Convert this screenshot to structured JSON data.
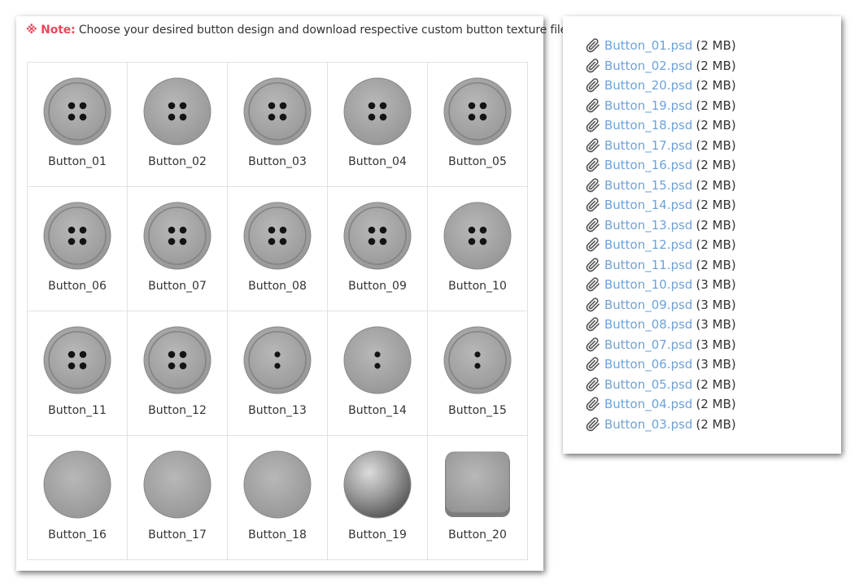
{
  "note": {
    "prefix": "※ Note:",
    "text": "Choose your desired button design and download respective custom button texture file"
  },
  "buttons": [
    {
      "label": "Button_01",
      "holes": 4,
      "rim": true
    },
    {
      "label": "Button_02",
      "holes": 4,
      "rim": false
    },
    {
      "label": "Button_03",
      "holes": 4,
      "rim": true
    },
    {
      "label": "Button_04",
      "holes": 4,
      "rim": false
    },
    {
      "label": "Button_05",
      "holes": 4,
      "rim": true
    },
    {
      "label": "Button_06",
      "holes": 4,
      "rim": true
    },
    {
      "label": "Button_07",
      "holes": 4,
      "rim": true
    },
    {
      "label": "Button_08",
      "holes": 4,
      "rim": true
    },
    {
      "label": "Button_09",
      "holes": 4,
      "rim": true
    },
    {
      "label": "Button_10",
      "holes": 4,
      "rim": false
    },
    {
      "label": "Button_11",
      "holes": 4,
      "rim": true
    },
    {
      "label": "Button_12",
      "holes": 4,
      "rim": true
    },
    {
      "label": "Button_13",
      "holes": 2,
      "rim": true
    },
    {
      "label": "Button_14",
      "holes": 2,
      "rim": false
    },
    {
      "label": "Button_15",
      "holes": 2,
      "rim": true
    },
    {
      "label": "Button_16",
      "holes": 0,
      "rim": false
    },
    {
      "label": "Button_17",
      "holes": 0,
      "rim": false
    },
    {
      "label": "Button_18",
      "holes": 0,
      "rim": false
    },
    {
      "label": "Button_19",
      "holes": 0,
      "rim": false,
      "shape": "sphere"
    },
    {
      "label": "Button_20",
      "holes": 0,
      "rim": false,
      "shape": "square"
    }
  ],
  "files": [
    {
      "name": "Button_01.psd",
      "size": "(2 MB)"
    },
    {
      "name": "Button_02.psd",
      "size": "(2 MB)"
    },
    {
      "name": "Button_20.psd",
      "size": "(2 MB)"
    },
    {
      "name": "Button_19.psd",
      "size": "(2 MB)"
    },
    {
      "name": "Button_18.psd",
      "size": "(2 MB)"
    },
    {
      "name": "Button_17.psd",
      "size": "(2 MB)"
    },
    {
      "name": "Button_16.psd",
      "size": "(2 MB)"
    },
    {
      "name": "Button_15.psd",
      "size": "(2 MB)"
    },
    {
      "name": "Button_14.psd",
      "size": "(2 MB)"
    },
    {
      "name": "Button_13.psd",
      "size": "(2 MB)"
    },
    {
      "name": "Button_12.psd",
      "size": "(2 MB)"
    },
    {
      "name": "Button_11.psd",
      "size": "(2 MB)"
    },
    {
      "name": "Button_10.psd",
      "size": "(3 MB)"
    },
    {
      "name": "Button_09.psd",
      "size": "(3 MB)"
    },
    {
      "name": "Button_08.psd",
      "size": "(3 MB)"
    },
    {
      "name": "Button_07.psd",
      "size": "(3 MB)"
    },
    {
      "name": "Button_06.psd",
      "size": "(3 MB)"
    },
    {
      "name": "Button_05.psd",
      "size": "(2 MB)"
    },
    {
      "name": "Button_04.psd",
      "size": "(2 MB)"
    },
    {
      "name": "Button_03.psd",
      "size": "(2 MB)"
    }
  ],
  "icons": {
    "attachment": "paperclip-icon"
  },
  "colors": {
    "note_accent": "#e8485a",
    "link": "#6ea2d8",
    "button_gray": "#a4a4a4"
  }
}
